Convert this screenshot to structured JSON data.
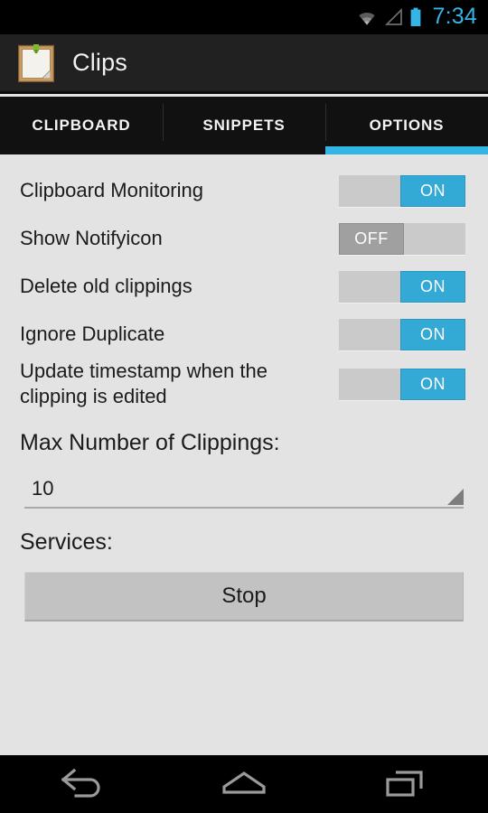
{
  "status_bar": {
    "time": "7:34",
    "icons": [
      "wifi-icon",
      "signal-icon",
      "battery-icon"
    ],
    "accent_color": "#33b5e5"
  },
  "action_bar": {
    "app_title": "Clips",
    "app_icon": "clipboard-note-icon",
    "background_color": "#212121"
  },
  "tabs": {
    "active_index": 2,
    "accent_color": "#33b5e5",
    "items": [
      {
        "label": "CLIPBOARD",
        "active": false
      },
      {
        "label": "SNIPPETS",
        "active": false
      },
      {
        "label": "OPTIONS",
        "active": true
      }
    ]
  },
  "options": {
    "settings": [
      {
        "label": "Clipboard Monitoring",
        "state": "ON"
      },
      {
        "label": "Show Notifyicon",
        "state": "OFF"
      },
      {
        "label": "Delete old clippings",
        "state": "ON"
      },
      {
        "label": "Ignore Duplicate",
        "state": "ON"
      },
      {
        "label": "Update timestamp when the clipping is edited",
        "state": "ON"
      }
    ],
    "switch_on_label": "ON",
    "switch_off_label": "OFF",
    "switch_on_color": "#33a9d6",
    "switch_off_color": "#a0a0a0",
    "max_clippings": {
      "title": "Max Number of Clippings:",
      "value": "10"
    },
    "services": {
      "title": "Services:",
      "button_label": "Stop"
    }
  },
  "nav_bar": {
    "buttons": [
      {
        "name": "back-icon"
      },
      {
        "name": "home-icon"
      },
      {
        "name": "recents-icon"
      }
    ]
  }
}
